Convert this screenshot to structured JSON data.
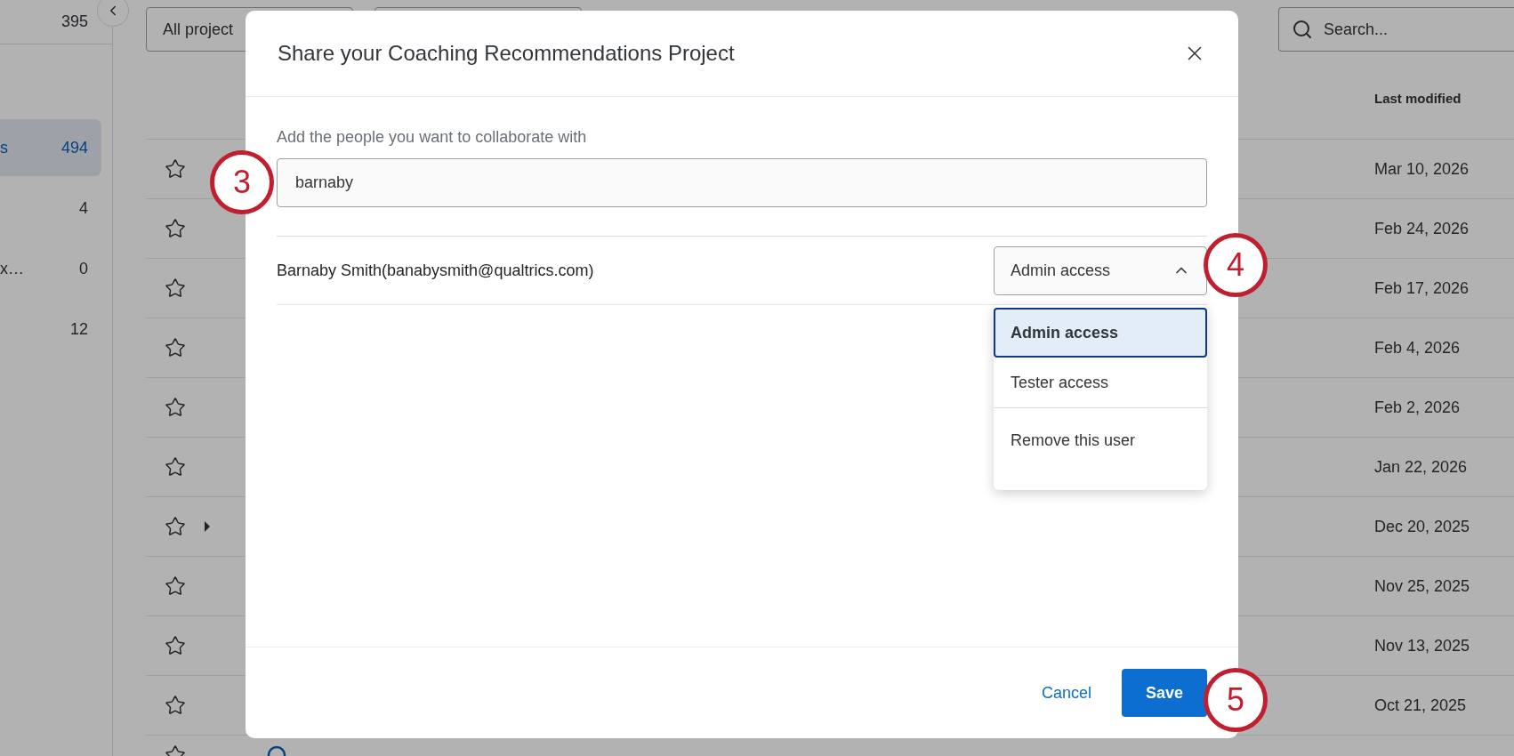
{
  "sidebar": {
    "top_count": "395",
    "items": [
      {
        "label": "s",
        "count": "494",
        "selected": true
      },
      {
        "count": "4",
        "selected": false
      },
      {
        "label": "x…",
        "count": "0",
        "selected": false
      },
      {
        "count": "12",
        "selected": false
      }
    ]
  },
  "filters": [
    "All project"
  ],
  "search": {
    "placeholder": "Search..."
  },
  "table": {
    "columns": [
      "Last modified"
    ],
    "rows": [
      {
        "date": "Mar 10, 2026",
        "expandable": false
      },
      {
        "date": "Feb 24, 2026",
        "expandable": false
      },
      {
        "date": "Feb 17, 2026",
        "expandable": false
      },
      {
        "date": "Feb 4, 2026",
        "expandable": false
      },
      {
        "date": "Feb 2, 2026",
        "expandable": false
      },
      {
        "date": "Jan 22, 2026",
        "expandable": false
      },
      {
        "date": "Dec 20, 2025",
        "expandable": true
      },
      {
        "date": "Nov 25, 2025",
        "expandable": false
      },
      {
        "date": "Nov 13, 2025",
        "expandable": false
      },
      {
        "date": "Oct 21, 2025",
        "expandable": false
      }
    ]
  },
  "dialog": {
    "title": "Share your Coaching Recommendations Project",
    "field_label": "Add the people you want to collaborate with",
    "field_value": "barnaby",
    "collaborators": [
      {
        "name": "Barnaby Smith(banabysmith@qualtrics.com)",
        "access": "Admin access",
        "expanded": true
      }
    ],
    "access_options": [
      {
        "label": "Admin access",
        "selected": true,
        "kind": "option"
      },
      {
        "label": "Tester access",
        "selected": false,
        "kind": "option"
      },
      {
        "label": "Remove this user",
        "selected": false,
        "kind": "action"
      }
    ],
    "buttons": {
      "cancel": "Cancel",
      "save": "Save"
    }
  },
  "callouts": [
    "3",
    "4",
    "5"
  ]
}
